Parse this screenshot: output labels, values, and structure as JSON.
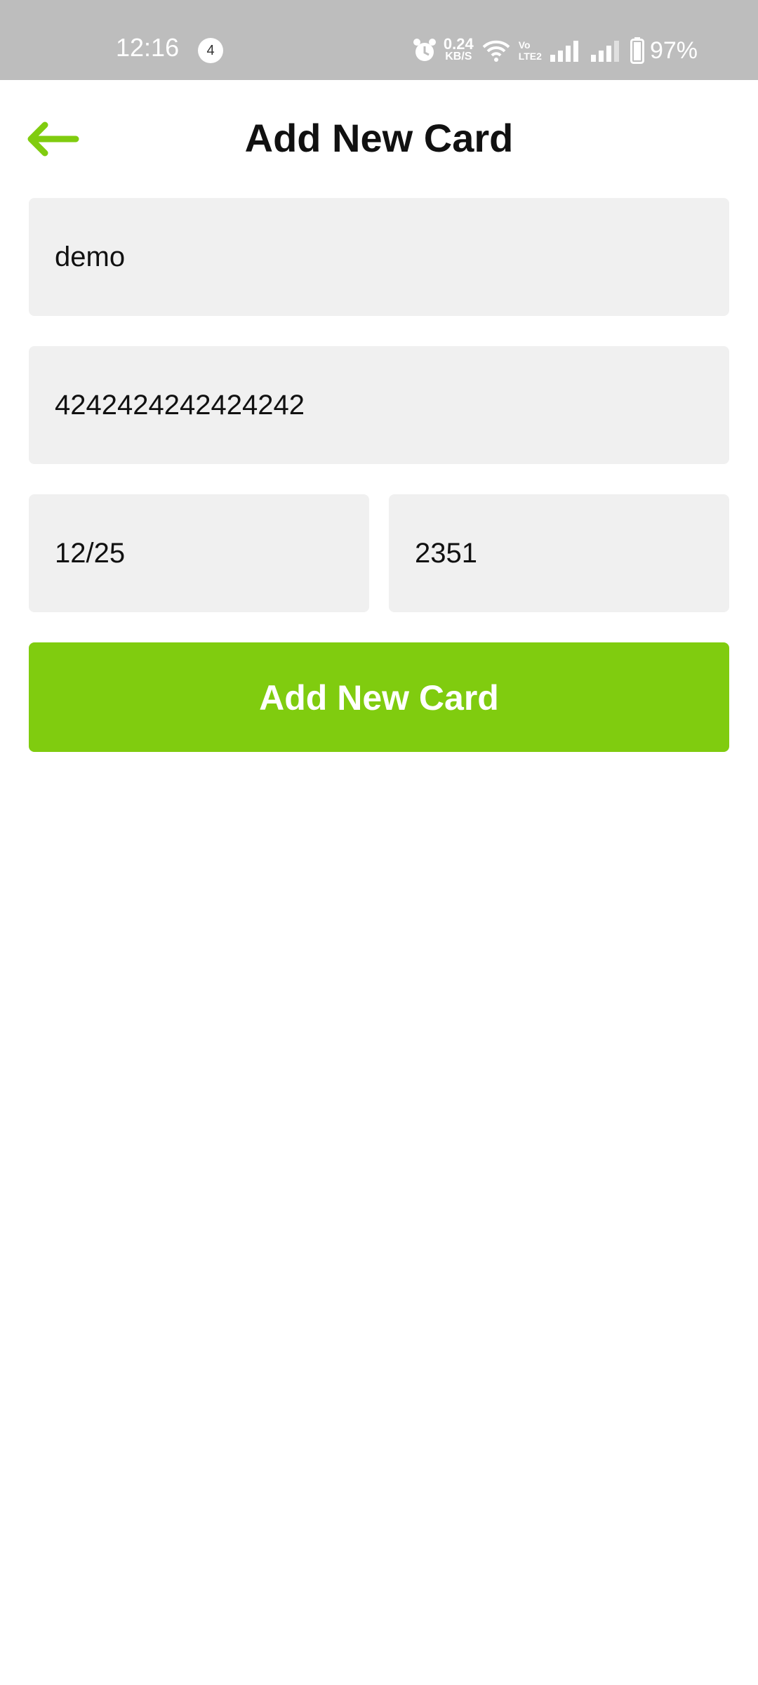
{
  "status_bar": {
    "time": "12:16",
    "notification_count": "4",
    "net_speed_value": "0.24",
    "net_speed_unit": "KB/S",
    "volte_top": "Vo",
    "volte_bottom": "LTE2",
    "battery_percent": "97%",
    "icons": [
      "alarm-icon",
      "wifi-icon",
      "volte-icon",
      "signal-icon",
      "signal-icon",
      "battery-icon"
    ]
  },
  "header": {
    "title": "Add New Card",
    "back_icon": "back-arrow-icon"
  },
  "form": {
    "cardholder_name": "demo",
    "card_number": "4242424242424242",
    "expiry": "12/25",
    "cvv": "2351",
    "submit_label": "Add New Card"
  },
  "colors": {
    "accent": "#80cc0f",
    "status_bar_bg": "#bdbdbd",
    "field_bg": "#f0f0f0"
  }
}
